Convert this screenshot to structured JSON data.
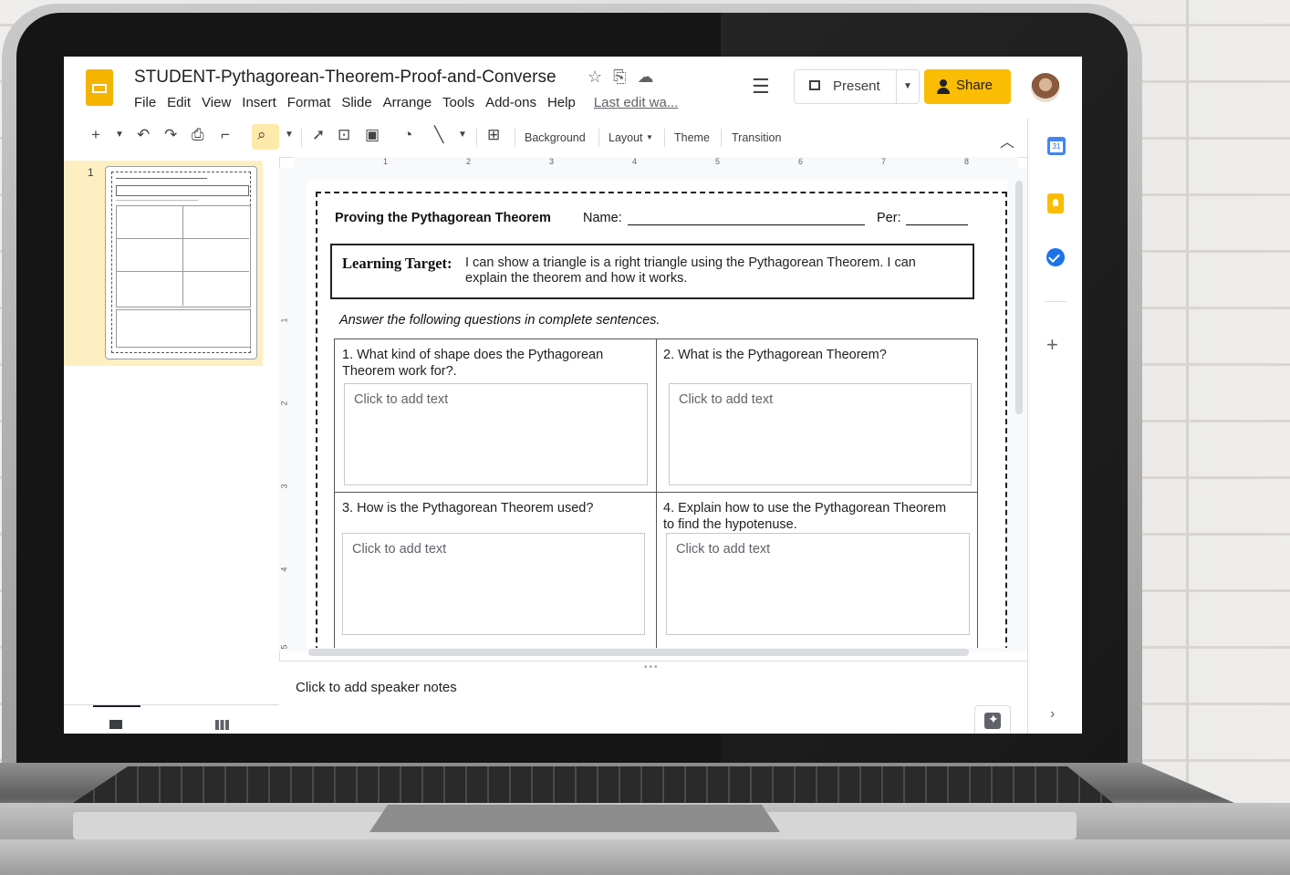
{
  "document": {
    "title": "STUDENT-Pythagorean-Theorem-Proof-and-Converse",
    "last_edit": "Last edit wa..."
  },
  "title_icons": [
    "star-icon",
    "move-to-folder-icon",
    "cloud-status-icon"
  ],
  "menu": [
    "File",
    "Edit",
    "View",
    "Insert",
    "Format",
    "Slide",
    "Arrange",
    "Tools",
    "Add-ons",
    "Help"
  ],
  "header": {
    "present_label": "Present",
    "share_label": "Share"
  },
  "toolbar": {
    "background_label": "Background",
    "layout_label": "Layout",
    "theme_label": "Theme",
    "transition_label": "Transition",
    "icons": [
      "new-slide-icon",
      "undo-icon",
      "redo-icon",
      "print-icon",
      "paint-format-icon",
      "zoom-icon",
      "select-icon",
      "textbox-icon",
      "image-icon",
      "shape-icon",
      "line-icon",
      "comment-add-icon"
    ]
  },
  "filmstrip": {
    "slide_number": "1"
  },
  "ruler": {
    "top_marks": [
      "1",
      "2",
      "3",
      "4",
      "5",
      "6",
      "7",
      "8"
    ],
    "left_marks": [
      "1",
      "2",
      "3",
      "4",
      "5"
    ]
  },
  "slide": {
    "title": "Proving the Pythagorean Theorem",
    "name_label": "Name:",
    "per_label": "Per:",
    "learning_target_label": "Learning Target:",
    "learning_target_line1": "I can show a triangle is a right triangle using the Pythagorean Theorem. I can",
    "learning_target_line2": "explain the theorem and how it works.",
    "instructions": "Answer the following questions in complete sentences.",
    "questions": [
      {
        "line1": "1. What kind of shape does the Pythagorean",
        "line2": "Theorem work for?.",
        "placeholder": "Click to add text"
      },
      {
        "line1": "2. What is the Pythagorean Theorem?",
        "line2": "",
        "placeholder": "Click to add text"
      },
      {
        "line1": "3. How is the Pythagorean Theorem used?",
        "line2": "",
        "placeholder": "Click to add text"
      },
      {
        "line1": "4. Explain how to use the Pythagorean Theorem",
        "line2": "to find the hypotenuse.",
        "placeholder": "Click to add text"
      }
    ]
  },
  "notes": {
    "placeholder": "Click to add speaker notes"
  },
  "side_panel": [
    "calendar-icon",
    "keep-icon",
    "tasks-icon",
    "add-icon"
  ],
  "colors": {
    "slides_yellow": "#f4b400",
    "share_yellow": "#fbbc04",
    "selected_slide": "#feefc3",
    "zoom_highlight": "#fde9a9"
  }
}
